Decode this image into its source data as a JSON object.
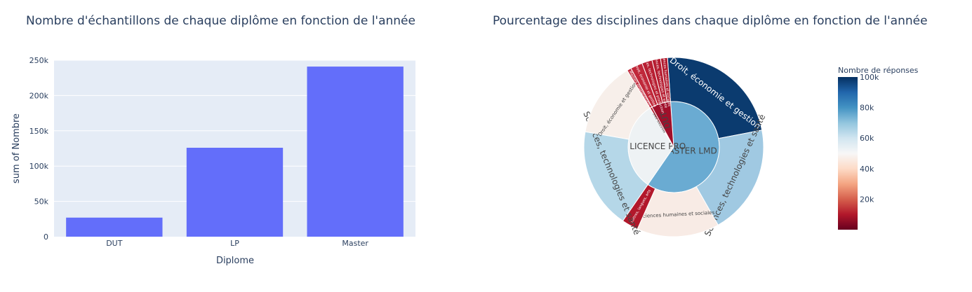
{
  "chart_data": [
    {
      "type": "bar",
      "title": "Nombre d'échantillons de chaque diplôme en fonction de l'année",
      "xlabel": "Diplome",
      "ylabel": "sum of Nombre",
      "categories": [
        "DUT",
        "LP",
        "Master"
      ],
      "values": [
        27000,
        126000,
        241000
      ],
      "ylim": [
        0,
        250000
      ],
      "yticks": [
        0,
        50000,
        100000,
        150000,
        200000,
        250000
      ],
      "ytick_labels": [
        "0",
        "50k",
        "100k",
        "150k",
        "200k",
        "250k"
      ],
      "bar_color": "#636efa",
      "plot_bg": "#e5ecf6",
      "grid": true
    },
    {
      "type": "sunburst",
      "title": "Pourcentage des disciplines dans chaque diplôme en fonction de l'année",
      "colorbar": {
        "title": "Nombre de réponses",
        "range": [
          0,
          100000
        ],
        "ticks": [
          20000,
          40000,
          60000,
          80000,
          100000
        ],
        "tick_labels": [
          "20k",
          "40k",
          "60k",
          "80k",
          "100k"
        ],
        "colorscale": [
          "#67001f",
          "#b2182b",
          "#d6604d",
          "#f4a582",
          "#fddbc7",
          "#f7f7f7",
          "#d1e5f0",
          "#92c5de",
          "#4393c3",
          "#2166ac",
          "#053061"
        ]
      },
      "nodes": [
        {
          "label": "MASTER LMD",
          "value": 241000,
          "color": "#6aabd2",
          "children": [
            {
              "label": "Droit, économie et gestion",
              "value": 70000,
              "color": "#0b3b6f"
            },
            {
              "label": "Sciences, technologies et santé",
              "value": 60000,
              "color": "#a0c9e2"
            },
            {
              "label": "Sciences humaines et sociales",
              "value": 45000,
              "color": "#f8ebe5"
            },
            {
              "label": "Lettres, langues, arts",
              "value": 9000,
              "color": "#b2182b"
            }
          ]
        },
        {
          "label": "LICENCE PRO",
          "value": 126000,
          "color": "#eef2f4",
          "children": [
            {
              "label": "Sciences, technologies et santé",
              "value": 64000,
              "color": "#b5d7e8"
            },
            {
              "label": "Droit, économie et gestion",
              "value": 48000,
              "color": "#f7efea"
            }
          ]
        },
        {
          "label": "MASTER ENS",
          "value": 3000,
          "color": "#b2182b",
          "children": [
            {
              "label": "Masters enseignement",
              "value": 6000,
              "color": "#c0283a"
            }
          ]
        },
        {
          "label": "DUT",
          "value": 27000,
          "color": "#a00f2a",
          "children": [
            {
              "label": "Droit, économie et gestion",
              "value": 7000,
              "color": "#c0283a"
            },
            {
              "label": "Sciences, technologies et production",
              "value": 6000,
              "color": "#b81f32"
            },
            {
              "label": "Sciences, technologies et santé",
              "value": 5000,
              "color": "#b51c30"
            },
            {
              "label": "Sciences humaines et sociales",
              "value": 4000,
              "color": "#b01a2e"
            }
          ]
        }
      ]
    }
  ]
}
